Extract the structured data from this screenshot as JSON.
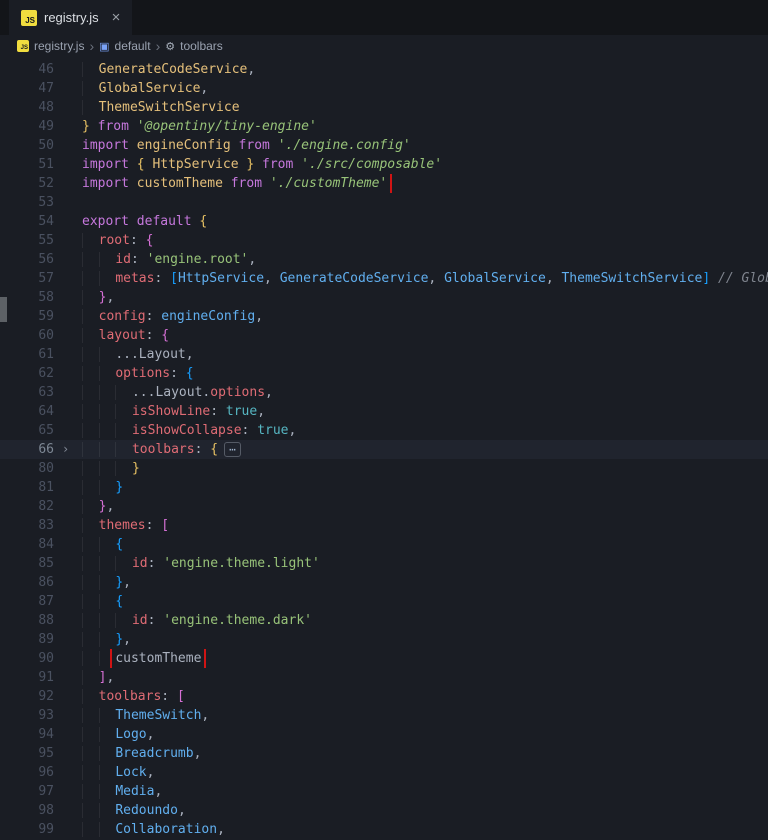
{
  "palette": {
    "editor_bg": "#1a1d24",
    "tabstrip_bg": "#131519",
    "annotation_red": "#d01414",
    "keyword": "#c678dd",
    "property": "#e06c75",
    "string": "#98c379",
    "identifier_import": "#e5c07b",
    "identifier_ref": "#61afef",
    "boolean": "#56b6c2",
    "comment": "#7f848e",
    "js_badge_bg": "#f1dd3f"
  },
  "tab": {
    "label": "registry.js"
  },
  "icons": {
    "js_badge": "JS",
    "close": "×",
    "crumb_separator": "›",
    "symbol_icon": "▣",
    "wrench_icon": "⚙",
    "fold_chevron": "›"
  },
  "breadcrumb": {
    "file": "registry.js",
    "symbol": "default",
    "member": "toolbars"
  },
  "editor": {
    "lines": [
      {
        "n": 46,
        "ind": 2,
        "tokens": [
          [
            "GenerateCodeService",
            "id"
          ],
          [
            ",",
            "fg"
          ]
        ]
      },
      {
        "n": 47,
        "ind": 2,
        "tokens": [
          [
            "GlobalService",
            "id"
          ],
          [
            ",",
            "fg"
          ]
        ]
      },
      {
        "n": 48,
        "ind": 2,
        "tokens": [
          [
            "ThemeSwitchService",
            "id"
          ]
        ]
      },
      {
        "n": 49,
        "ind": 0,
        "tokens": [
          [
            "} ",
            "b1"
          ],
          [
            "from",
            "kw"
          ],
          [
            " ",
            "fg"
          ],
          [
            "'@opentiny/tiny-engine'",
            "stri"
          ]
        ]
      },
      {
        "n": 50,
        "ind": 0,
        "tokens": [
          [
            "import",
            "kw"
          ],
          [
            " ",
            "fg"
          ],
          [
            "engineConfig",
            "id"
          ],
          [
            " ",
            "fg"
          ],
          [
            "from",
            "kw"
          ],
          [
            " ",
            "fg"
          ],
          [
            "'./engine.config'",
            "stri"
          ]
        ]
      },
      {
        "n": 51,
        "ind": 0,
        "tokens": [
          [
            "import",
            "kw"
          ],
          [
            " ",
            "fg"
          ],
          [
            "{ ",
            "b1"
          ],
          [
            "HttpService",
            "id"
          ],
          [
            " }",
            "b1"
          ],
          [
            " ",
            "fg"
          ],
          [
            "from",
            "kw"
          ],
          [
            " ",
            "fg"
          ],
          [
            "'./src/composable'",
            "stri"
          ]
        ]
      },
      {
        "n": 52,
        "ind": 0,
        "box": true,
        "tokens": [
          [
            "import",
            "kw"
          ],
          [
            " ",
            "fg"
          ],
          [
            "customTheme",
            "id"
          ],
          [
            " ",
            "fg"
          ],
          [
            "from",
            "kw"
          ],
          [
            " ",
            "fg"
          ],
          [
            "'./customTheme'",
            "stri"
          ]
        ]
      },
      {
        "n": 53,
        "ind": 0,
        "tokens": []
      },
      {
        "n": 54,
        "ind": 0,
        "tokens": [
          [
            "export",
            "kw"
          ],
          [
            " ",
            "fg"
          ],
          [
            "default",
            "kw"
          ],
          [
            " ",
            "fg"
          ],
          [
            "{",
            "b1"
          ]
        ]
      },
      {
        "n": 55,
        "ind": 2,
        "tokens": [
          [
            "root",
            "prop"
          ],
          [
            ": ",
            "fg"
          ],
          [
            "{",
            "b2"
          ]
        ]
      },
      {
        "n": 56,
        "ind": 4,
        "tokens": [
          [
            "id",
            "prop"
          ],
          [
            ": ",
            "fg"
          ],
          [
            "'engine.root'",
            "str"
          ],
          [
            ",",
            "fg"
          ]
        ]
      },
      {
        "n": 57,
        "ind": 4,
        "tokens": [
          [
            "metas",
            "prop"
          ],
          [
            ": ",
            "fg"
          ],
          [
            "[",
            "b3"
          ],
          [
            "HttpService",
            "idb"
          ],
          [
            ", ",
            "fg"
          ],
          [
            "GenerateCodeService",
            "idb"
          ],
          [
            ", ",
            "fg"
          ],
          [
            "GlobalService",
            "idb"
          ],
          [
            ", ",
            "fg"
          ],
          [
            "ThemeSwitchService",
            "idb"
          ],
          [
            "]",
            "b3"
          ],
          [
            " ",
            "fg"
          ],
          [
            "// Globa",
            "cmt"
          ]
        ]
      },
      {
        "n": 58,
        "ind": 2,
        "tokens": [
          [
            "}",
            "b2"
          ],
          [
            ",",
            "fg"
          ]
        ]
      },
      {
        "n": 59,
        "ind": 2,
        "tokens": [
          [
            "config",
            "prop"
          ],
          [
            ": ",
            "fg"
          ],
          [
            "engineConfig",
            "idb"
          ],
          [
            ",",
            "fg"
          ]
        ]
      },
      {
        "n": 60,
        "ind": 2,
        "tokens": [
          [
            "layout",
            "prop"
          ],
          [
            ": ",
            "fg"
          ],
          [
            "{",
            "b2"
          ]
        ]
      },
      {
        "n": 61,
        "ind": 4,
        "tokens": [
          [
            "...Layout",
            "fg"
          ],
          [
            ",",
            "fg"
          ]
        ]
      },
      {
        "n": 62,
        "ind": 4,
        "tokens": [
          [
            "options",
            "prop"
          ],
          [
            ": ",
            "fg"
          ],
          [
            "{",
            "b3"
          ]
        ]
      },
      {
        "n": 63,
        "ind": 6,
        "tokens": [
          [
            "...Layout.",
            "fg"
          ],
          [
            "options",
            "prop"
          ],
          [
            ",",
            "fg"
          ]
        ]
      },
      {
        "n": 64,
        "ind": 6,
        "tokens": [
          [
            "isShowLine",
            "prop"
          ],
          [
            ": ",
            "fg"
          ],
          [
            "true",
            "bool"
          ],
          [
            ",",
            "fg"
          ]
        ]
      },
      {
        "n": 65,
        "ind": 6,
        "tokens": [
          [
            "isShowCollapse",
            "prop"
          ],
          [
            ": ",
            "fg"
          ],
          [
            "true",
            "bool"
          ],
          [
            ",",
            "fg"
          ]
        ]
      },
      {
        "n": 66,
        "ind": 6,
        "fold": true,
        "hl": true,
        "tokens": [
          [
            "toolbars",
            "prop"
          ],
          [
            ": ",
            "fg"
          ],
          [
            "{",
            "b1"
          ],
          [
            "⋯",
            "fold"
          ]
        ]
      },
      {
        "n": 80,
        "ind": 6,
        "tokens": [
          [
            "}",
            "b1"
          ]
        ]
      },
      {
        "n": 81,
        "ind": 4,
        "tokens": [
          [
            "}",
            "b3"
          ]
        ]
      },
      {
        "n": 82,
        "ind": 2,
        "tokens": [
          [
            "}",
            "b2"
          ],
          [
            ",",
            "fg"
          ]
        ]
      },
      {
        "n": 83,
        "ind": 2,
        "tokens": [
          [
            "themes",
            "prop"
          ],
          [
            ": ",
            "fg"
          ],
          [
            "[",
            "b2"
          ]
        ]
      },
      {
        "n": 84,
        "ind": 4,
        "tokens": [
          [
            "{",
            "b3"
          ]
        ]
      },
      {
        "n": 85,
        "ind": 6,
        "tokens": [
          [
            "id",
            "prop"
          ],
          [
            ": ",
            "fg"
          ],
          [
            "'engine.theme.light'",
            "str"
          ]
        ]
      },
      {
        "n": 86,
        "ind": 4,
        "tokens": [
          [
            "}",
            "b3"
          ],
          [
            ",",
            "fg"
          ]
        ]
      },
      {
        "n": 87,
        "ind": 4,
        "tokens": [
          [
            "{",
            "b3"
          ]
        ]
      },
      {
        "n": 88,
        "ind": 6,
        "tokens": [
          [
            "id",
            "prop"
          ],
          [
            ": ",
            "fg"
          ],
          [
            "'engine.theme.dark'",
            "str"
          ]
        ]
      },
      {
        "n": 89,
        "ind": 4,
        "tokens": [
          [
            "}",
            "b3"
          ],
          [
            ",",
            "fg"
          ]
        ]
      },
      {
        "n": 90,
        "ind": 4,
        "box": true,
        "tokens": [
          [
            "customTheme",
            "fg"
          ]
        ]
      },
      {
        "n": 91,
        "ind": 2,
        "tokens": [
          [
            "]",
            "b2"
          ],
          [
            ",",
            "fg"
          ]
        ]
      },
      {
        "n": 92,
        "ind": 2,
        "tokens": [
          [
            "toolbars",
            "prop"
          ],
          [
            ": ",
            "fg"
          ],
          [
            "[",
            "b2"
          ]
        ]
      },
      {
        "n": 93,
        "ind": 4,
        "tokens": [
          [
            "ThemeSwitch",
            "idb"
          ],
          [
            ",",
            "fg"
          ]
        ]
      },
      {
        "n": 94,
        "ind": 4,
        "tokens": [
          [
            "Logo",
            "idb"
          ],
          [
            ",",
            "fg"
          ]
        ]
      },
      {
        "n": 95,
        "ind": 4,
        "tokens": [
          [
            "Breadcrumb",
            "idb"
          ],
          [
            ",",
            "fg"
          ]
        ]
      },
      {
        "n": 96,
        "ind": 4,
        "tokens": [
          [
            "Lock",
            "idb"
          ],
          [
            ",",
            "fg"
          ]
        ]
      },
      {
        "n": 97,
        "ind": 4,
        "tokens": [
          [
            "Media",
            "idb"
          ],
          [
            ",",
            "fg"
          ]
        ]
      },
      {
        "n": 98,
        "ind": 4,
        "tokens": [
          [
            "Redoundo",
            "idb"
          ],
          [
            ",",
            "fg"
          ]
        ]
      },
      {
        "n": 99,
        "ind": 4,
        "tokens": [
          [
            "Collaboration",
            "idb"
          ],
          [
            ",",
            "fg"
          ]
        ]
      }
    ]
  }
}
